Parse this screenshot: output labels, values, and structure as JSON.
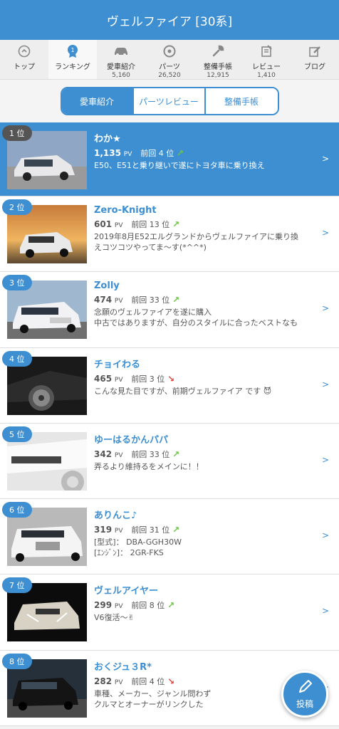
{
  "header": {
    "title": "ヴェルファイア [30系]"
  },
  "tabs": [
    {
      "label": "トップ",
      "count": "",
      "icon": "top-icon"
    },
    {
      "label": "ランキング",
      "count": "",
      "icon": "ranking-icon"
    },
    {
      "label": "愛車紹介",
      "count": "5,160",
      "icon": "car-icon"
    },
    {
      "label": "パーツ",
      "count": "26,520",
      "icon": "parts-icon"
    },
    {
      "label": "整備手帳",
      "count": "12,915",
      "icon": "wrench-icon"
    },
    {
      "label": "レビュー",
      "count": "1,410",
      "icon": "review-icon"
    },
    {
      "label": "ブログ",
      "count": "",
      "icon": "blog-icon"
    }
  ],
  "segments": [
    "愛車紹介",
    "パーツレビュー",
    "整備手帳"
  ],
  "ranking": [
    {
      "rank": "1 位",
      "name": "わか★",
      "pv": "1,135",
      "pv_unit": "PV",
      "prev": "前回 4 位",
      "trend": "↗",
      "desc1": "E50、E51と乗り継いで遂にトヨタ車に乗り換え",
      "desc2": ""
    },
    {
      "rank": "2 位",
      "name": "Zero-Knight",
      "pv": "601",
      "pv_unit": "PV",
      "prev": "前回 13 位",
      "trend": "↗",
      "desc1": "2019年8月E52エルグランドからヴェルファイアに乗り換",
      "desc2": "えコツコツやってま～す(*^^*)"
    },
    {
      "rank": "3 位",
      "name": "Zolly",
      "pv": "474",
      "pv_unit": "PV",
      "prev": "前回 33 位",
      "trend": "↗",
      "desc1": "念願のヴェルファイアを遂に購入",
      "desc2": "中古ではありますが、自分のスタイルに合ったベストなも"
    },
    {
      "rank": "4 位",
      "name": "チョイわる",
      "pv": "465",
      "pv_unit": "PV",
      "prev": "前回 3 位",
      "trend": "↘",
      "desc1": "こんな見た目ですが、前期ヴェルファイア です 😈",
      "desc2": ""
    },
    {
      "rank": "5 位",
      "name": "ゆーはるかんパパ",
      "pv": "342",
      "pv_unit": "PV",
      "prev": "前回 33 位",
      "trend": "↗",
      "desc1": "弄るより維持るをメインに！！",
      "desc2": ""
    },
    {
      "rank": "6 位",
      "name": "ありんこ♪",
      "pv": "319",
      "pv_unit": "PV",
      "prev": "前回 31 位",
      "trend": "↗",
      "desc1": "[型式]： DBA-GGH30W",
      "desc2": "[ｴﾝｼﾞﾝ]： 2GR-FKS"
    },
    {
      "rank": "7 位",
      "name": "ヴェルアイヤー",
      "pv": "299",
      "pv_unit": "PV",
      "prev": "前回 8 位",
      "trend": "↗",
      "desc1": "V6復活～✌",
      "desc2": ""
    },
    {
      "rank": "8 位",
      "name": "おくジュ３R*",
      "pv": "282",
      "pv_unit": "PV",
      "prev": "前回 4 位",
      "trend": "↘",
      "desc1": "車種、メーカー、ジャンル問わず",
      "desc2": "クルマとオーナーがリンクした"
    }
  ],
  "fab": {
    "label": "投稿"
  },
  "chevron": ">"
}
